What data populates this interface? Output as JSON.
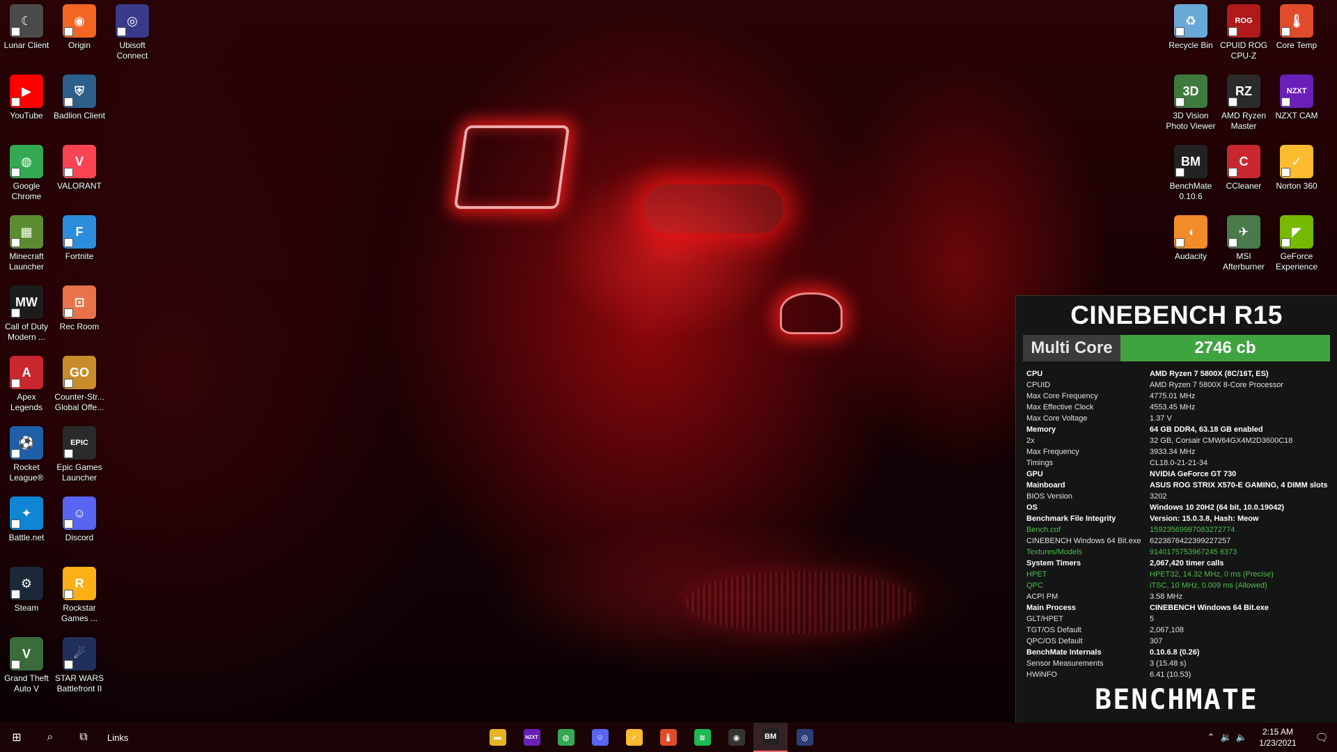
{
  "desktop_icons_left": [
    {
      "name": "lunar-client",
      "label": "Lunar Client",
      "glyph": "☾",
      "color": "#4a4a4a"
    },
    {
      "name": "origin",
      "label": "Origin",
      "glyph": "◉",
      "color": "#f26522"
    },
    {
      "name": "ubisoft-connect",
      "label": "Ubisoft Connect",
      "glyph": "◎",
      "color": "#3a3a8a"
    },
    {
      "name": "youtube",
      "label": "YouTube",
      "glyph": "▶",
      "color": "#ff0000"
    },
    {
      "name": "badlion-client",
      "label": "Badlion Client",
      "glyph": "⛨",
      "color": "#2c5f8a"
    },
    {
      "name": "google-chrome",
      "label": "Google Chrome",
      "glyph": "◍",
      "color": "#34a853"
    },
    {
      "name": "valorant",
      "label": "VALORANT",
      "glyph": "V",
      "color": "#fa4454"
    },
    {
      "name": "minecraft-launcher",
      "label": "Minecraft Launcher",
      "glyph": "▦",
      "color": "#5b8c32"
    },
    {
      "name": "fortnite",
      "label": "Fortnite",
      "glyph": "F",
      "color": "#2b8ddb"
    },
    {
      "name": "call-of-duty",
      "label": "Call of Duty Modern ...",
      "glyph": "MW",
      "color": "#1c1c1c"
    },
    {
      "name": "rec-room",
      "label": "Rec Room",
      "glyph": "⊡",
      "color": "#e8734a"
    },
    {
      "name": "apex-legends",
      "label": "Apex Legends",
      "glyph": "A",
      "color": "#c8282d"
    },
    {
      "name": "counter-strike",
      "label": "Counter-Str... Global Offe...",
      "glyph": "GO",
      "color": "#c88d2a"
    },
    {
      "name": "rocket-league",
      "label": "Rocket League®",
      "glyph": "⚽",
      "color": "#1f5fa8"
    },
    {
      "name": "epic-games-launcher",
      "label": "Epic Games Launcher",
      "glyph": "EPIC",
      "color": "#2a2a2a"
    },
    {
      "name": "battle-net",
      "label": "Battle.net",
      "glyph": "✦",
      "color": "#0e86d4"
    },
    {
      "name": "discord",
      "label": "Discord",
      "glyph": "☺",
      "color": "#5865f2"
    },
    {
      "name": "steam",
      "label": "Steam",
      "glyph": "⚙",
      "color": "#1b2838"
    },
    {
      "name": "rockstar-games",
      "label": "Rockstar Games ...",
      "glyph": "R",
      "color": "#fcaf17"
    },
    {
      "name": "grand-theft-auto-v",
      "label": "Grand Theft Auto V",
      "glyph": "V",
      "color": "#3a6b3a"
    },
    {
      "name": "star-wars-battlefront",
      "label": "STAR WARS Battlefront II",
      "glyph": "☄",
      "color": "#20305a"
    }
  ],
  "desktop_icons_right": [
    {
      "name": "recycle-bin",
      "label": "Recycle Bin",
      "glyph": "♻",
      "color": "#6aa8d8"
    },
    {
      "name": "cpuid-rog-cpuz",
      "label": "CPUID ROG CPU-Z",
      "glyph": "ROG",
      "color": "#b01a1a"
    },
    {
      "name": "core-temp",
      "label": "Core Temp",
      "glyph": "🌡",
      "color": "#e04b2a"
    },
    {
      "name": "3d-vision-photo-viewer",
      "label": "3D Vision Photo Viewer",
      "glyph": "3D",
      "color": "#3d7a3d"
    },
    {
      "name": "amd-ryzen-master",
      "label": "AMD Ryzen Master",
      "glyph": "RZ",
      "color": "#2a2a2a"
    },
    {
      "name": "nzxt-cam",
      "label": "NZXT CAM",
      "glyph": "NZXT",
      "color": "#6a1fb8"
    },
    {
      "name": "benchmate",
      "label": "BenchMate 0.10.6",
      "glyph": "BM",
      "color": "#222"
    },
    {
      "name": "ccleaner",
      "label": "CCleaner",
      "glyph": "C",
      "color": "#c8282d"
    },
    {
      "name": "norton-360",
      "label": "Norton 360",
      "glyph": "✓",
      "color": "#fdbb2f"
    },
    {
      "name": "audacity",
      "label": "Audacity",
      "glyph": "◖",
      "color": "#f28c28"
    },
    {
      "name": "msi-afterburner",
      "label": "MSI Afterburner",
      "glyph": "✈",
      "color": "#4a7a4a"
    },
    {
      "name": "geforce-experience",
      "label": "GeForce Experience",
      "glyph": "◤",
      "color": "#76b900"
    }
  ],
  "bench": {
    "title": "CINEBENCH R15",
    "mode": "Multi Core",
    "score": "2746 cb",
    "rows": [
      {
        "k": "CPU",
        "v": "AMD Ryzen 7 5800X (8C/16T, ES)",
        "style": "bold"
      },
      {
        "k": "CPUID",
        "v": "AMD Ryzen 7 5800X 8-Core Processor",
        "style": ""
      },
      {
        "k": "Max Core Frequency",
        "v": "4775.01 MHz",
        "style": ""
      },
      {
        "k": "Max Effective Clock",
        "v": "4553.45 MHz",
        "style": ""
      },
      {
        "k": "Max Core Voltage",
        "v": "1.37 V",
        "style": ""
      },
      {
        "k": "Memory",
        "v": "64 GB DDR4, 63.18 GB enabled",
        "style": "bold"
      },
      {
        "k": "2x",
        "v": "32 GB, Corsair CMW64GX4M2D3600C18",
        "style": ""
      },
      {
        "k": "Max Frequency",
        "v": "3933.34 MHz",
        "style": ""
      },
      {
        "k": "Timings",
        "v": "CL18.0-21-21-34",
        "style": ""
      },
      {
        "k": "GPU",
        "v": "NVIDIA GeForce GT 730",
        "style": "bold"
      },
      {
        "k": "Mainboard",
        "v": "ASUS ROG STRIX X570-E GAMING, 4 DIMM slots",
        "style": "bold"
      },
      {
        "k": "BIOS Version",
        "v": "3202",
        "style": ""
      },
      {
        "k": "OS",
        "v": "Windows 10 20H2 (64 bit, 10.0.19042)",
        "style": "bold"
      },
      {
        "k": "Benchmark File Integrity",
        "v": "Version: 15.0.3.8, Hash: Meow",
        "style": "bold"
      },
      {
        "k": "Bench.cof",
        "v": "15923569987083272774",
        "style": "green"
      },
      {
        "k": "CINEBENCH Windows 64 Bit.exe",
        "v": "6223876422399227257",
        "style": ""
      },
      {
        "k": "Textures/Models",
        "v": "9140175753967245 6373",
        "style": "green"
      },
      {
        "k": "System Timers",
        "v": "2,067,420 timer calls",
        "style": "bold"
      },
      {
        "k": "HPET",
        "v": "HPET32, 14.32 MHz, 0 ms (Precise)",
        "style": "green"
      },
      {
        "k": "QPC",
        "v": "iTSC, 10 MHz, 0.009 ms (Allowed)",
        "style": "green"
      },
      {
        "k": "ACPI PM",
        "v": "3.58 MHz",
        "style": ""
      },
      {
        "k": "Main Process",
        "v": "CINEBENCH Windows 64 Bit.exe",
        "style": "bold"
      },
      {
        "k": "GLT/HPET",
        "v": "5",
        "style": ""
      },
      {
        "k": "TGT/OS Default",
        "v": "2,067,108",
        "style": ""
      },
      {
        "k": "QPC/OS Default",
        "v": "307",
        "style": ""
      },
      {
        "k": "BenchMate Internals",
        "v": "0.10.6.8 (0.26)",
        "style": "bold"
      },
      {
        "k": "Sensor Measurements",
        "v": "3 (15.48 s)",
        "style": ""
      },
      {
        "k": "HWiNFO",
        "v": "6.41 (10.53)",
        "style": ""
      }
    ],
    "brand": "BENCHMATE"
  },
  "taskbar": {
    "links_label": "Links",
    "pinned": [
      {
        "name": "file-explorer",
        "glyph": "▬",
        "color": "#e6b422"
      },
      {
        "name": "nzxt-cam",
        "glyph": "NZXT",
        "color": "#6a1fb8"
      },
      {
        "name": "google-chrome",
        "glyph": "◍",
        "color": "#34a853"
      },
      {
        "name": "discord",
        "glyph": "☺",
        "color": "#5865f2"
      },
      {
        "name": "norton-360",
        "glyph": "✓",
        "color": "#fdbb2f"
      },
      {
        "name": "core-temp",
        "glyph": "🌡",
        "color": "#e04b2a"
      },
      {
        "name": "spotify",
        "glyph": "≋",
        "color": "#1db954"
      },
      {
        "name": "obs-studio",
        "glyph": "◉",
        "color": "#333"
      },
      {
        "name": "benchmate",
        "glyph": "BM",
        "color": "#222",
        "active": true
      },
      {
        "name": "cinebench",
        "glyph": "◎",
        "color": "#2a3f7a"
      }
    ],
    "clock_time": "2:15 AM",
    "clock_date": "1/23/2021"
  }
}
